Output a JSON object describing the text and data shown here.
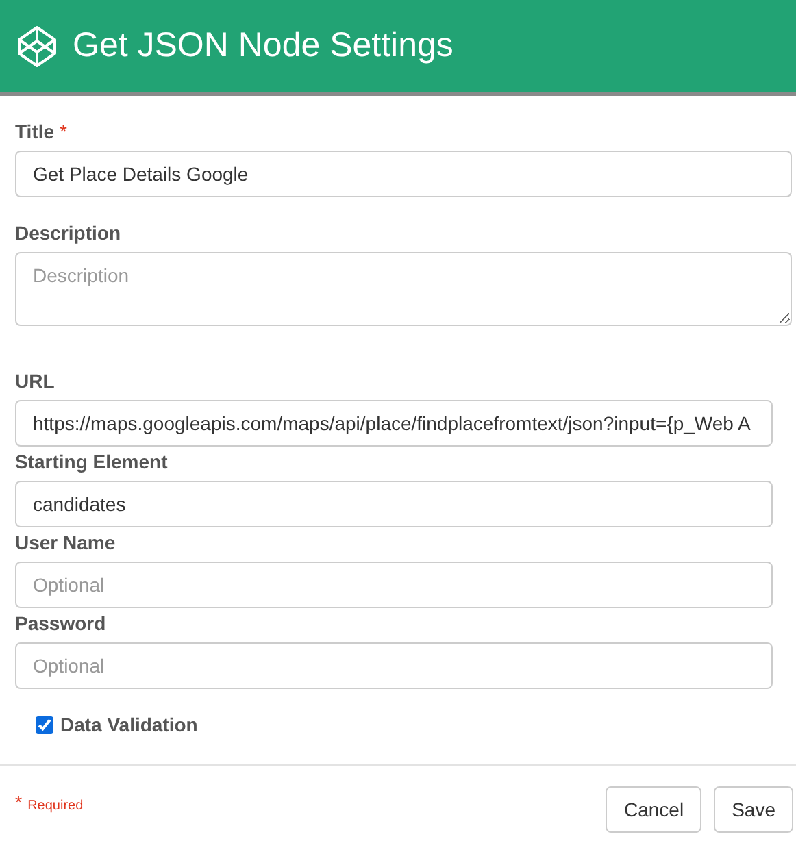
{
  "window": {
    "title": "Get JSON Node Settings"
  },
  "fields": [
    {
      "label": "Title",
      "required": true,
      "kind": "input",
      "value": "Get Place Details Google"
    },
    {
      "label": "Description",
      "required": false,
      "kind": "textarea",
      "placeholder": "Description"
    },
    {
      "label": "URL",
      "required": false,
      "kind": "input",
      "value": "https://maps.googleapis.com/maps/api/place/findplacefromtext/json?input={p_Web A"
    },
    {
      "label": "Starting Element",
      "required": false,
      "kind": "input",
      "value": "candidates"
    },
    {
      "label": "User Name",
      "required": false,
      "kind": "input",
      "placeholder": "Optional"
    },
    {
      "label": "Password",
      "required": false,
      "kind": "input",
      "placeholder": "Optional"
    }
  ],
  "checkbox": {
    "label": "Data Validation",
    "checked": true
  },
  "footer": {
    "required_mark": "*",
    "required_note": "Required",
    "buttons": [
      "Cancel",
      "Save"
    ]
  }
}
